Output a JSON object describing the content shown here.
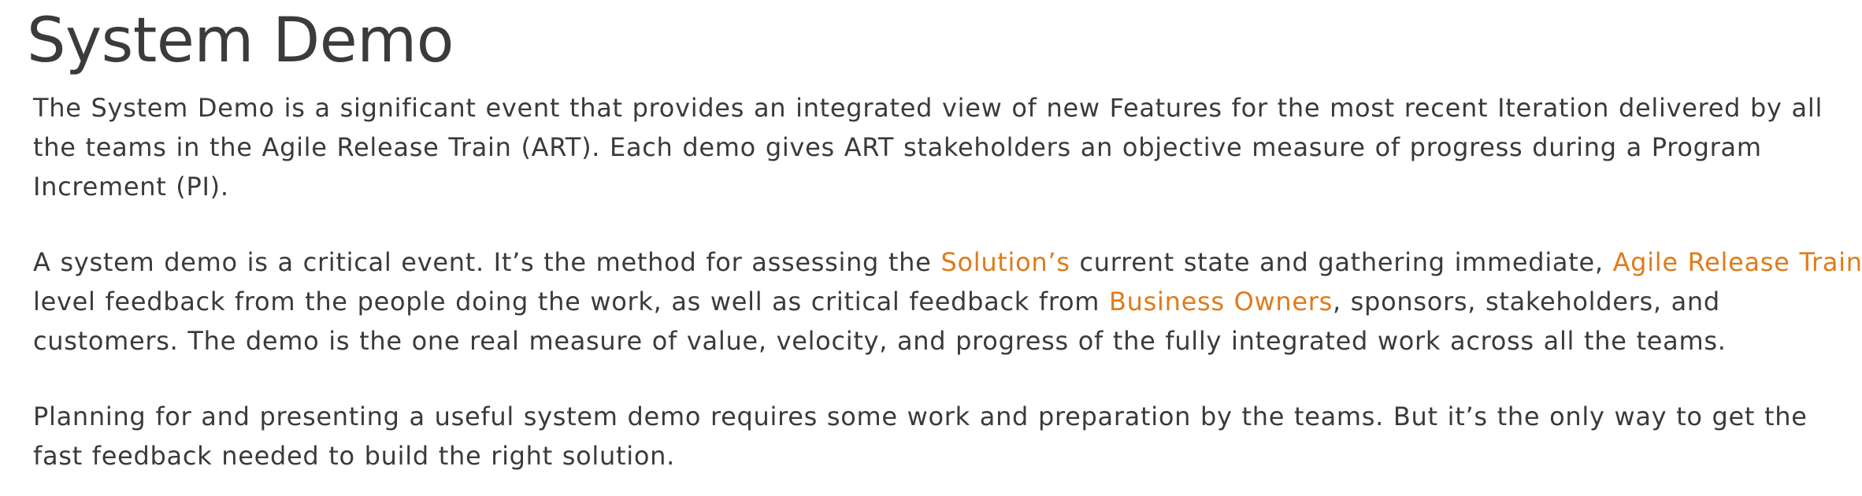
{
  "title": "System Demo",
  "paragraphs": [
    {
      "lines": [
        "The System Demo is a significant event that provides an integrated view of new Features for the most recent Iteration delivered by all",
        "the teams in the Agile Release Train (ART). Each demo gives ART stakeholders an objective measure of progress during a Program",
        "Increment (PI)."
      ]
    },
    {
      "line1_a": "A system demo is a critical event. It’s the method for assessing the ",
      "link_solutions": "Solution’s",
      "line1_b": " current state and gathering immediate, ",
      "link_art": "Agile Release Train",
      "line1_c": "-",
      "line2_a": "level feedback from the people doing the work, as well as critical feedback from ",
      "link_business_owners": "Business Owners",
      "line2_b": ", sponsors, stakeholders, and",
      "line3": "customers. The demo is the one real measure of value, velocity, and progress of the fully integrated work across all the teams."
    },
    {
      "lines": [
        "Planning for and presenting a useful system demo requires some work and preparation by the teams. But it’s the only way to get the",
        "fast feedback needed to build the right solution."
      ]
    }
  ],
  "colors": {
    "text": "#3a3a3a",
    "link": "#e07b1a",
    "background": "#ffffff"
  }
}
